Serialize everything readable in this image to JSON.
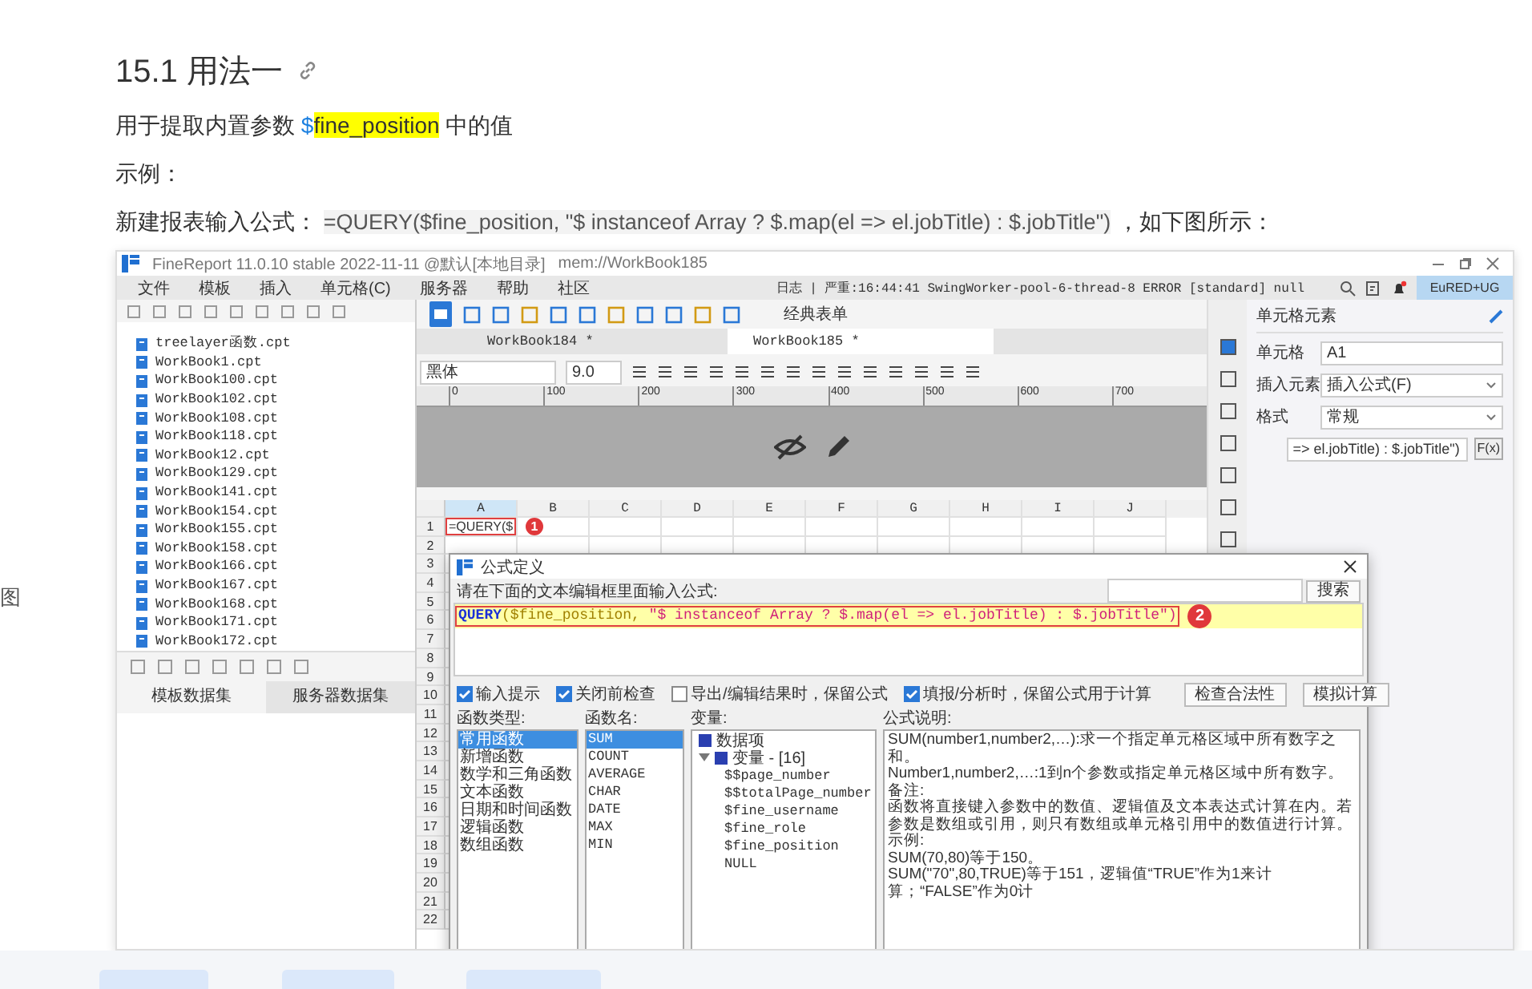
{
  "article": {
    "heading": "15.1 用法一",
    "paragraphs": [
      [
        {
          "text": "用于提取内置参数 ",
          "kind": "plain"
        },
        {
          "text": "$",
          "kind": "dollar"
        },
        {
          "text": "fine_position",
          "kind": "highlight"
        },
        {
          "text": " 中的值",
          "kind": "plain"
        }
      ],
      [
        {
          "text": "示例：",
          "kind": "plain"
        }
      ],
      [
        {
          "text": "新建报表输入公式： ",
          "kind": "plain"
        },
        {
          "text": "=QUERY($",
          "kind": "code"
        },
        {
          "text": "fine_position",
          "kind": "code-highlight"
        },
        {
          "text": ", \"$ instanceof Array ? $.map(el => el.jobTitle) : $.jobTitle\")",
          "kind": "code"
        },
        {
          "text": " ，如下图所示：",
          "kind": "plain"
        }
      ]
    ]
  },
  "left_fragment": "图",
  "app": {
    "title": "FineReport 11.0.10 stable 2022-11-11 @默认[本地目录]",
    "path": "mem://WorkBook185",
    "menu": [
      "文件",
      "模板",
      "插入",
      "单元格(C)",
      "服务器",
      "帮助",
      "社区"
    ],
    "log": "日志 | 严重:16:44:41 SwingWorker-pool-6-thread-8 ERROR [standard] null",
    "user": "EuRED+UG",
    "files": [
      "treelayer函数.cpt",
      "WorkBook1.cpt",
      "WorkBook100.cpt",
      "WorkBook102.cpt",
      "WorkBook108.cpt",
      "WorkBook118.cpt",
      "WorkBook12.cpt",
      "WorkBook129.cpt",
      "WorkBook141.cpt",
      "WorkBook154.cpt",
      "WorkBook155.cpt",
      "WorkBook158.cpt",
      "WorkBook166.cpt",
      "WorkBook167.cpt",
      "WorkBook168.cpt",
      "WorkBook171.cpt",
      "WorkBook172.cpt"
    ],
    "dataset_tabs": [
      {
        "label": "模板数据集",
        "selected": true
      },
      {
        "label": "服务器数据集",
        "selected": false
      }
    ],
    "style_button": "经典表单",
    "doc_tabs": [
      {
        "label": "WorkBook184 *",
        "selected": false
      },
      {
        "label": "WorkBook185 *",
        "selected": true
      }
    ],
    "font": "黑体",
    "font_size": "9.0",
    "ruler": [
      "0",
      "100",
      "200",
      "300",
      "400",
      "500",
      "600",
      "700"
    ],
    "grid": {
      "columns": [
        "A",
        "B",
        "C",
        "D",
        "E",
        "F",
        "G",
        "H",
        "I",
        "J"
      ],
      "rows": [
        {
          "label": "1",
          "cell": "=QUERY($"
        },
        {
          "label": "2"
        },
        {
          "label": "3"
        },
        {
          "label": "4"
        },
        {
          "label": "5"
        },
        {
          "label": "6"
        },
        {
          "label": "7"
        },
        {
          "label": "8"
        },
        {
          "label": "9"
        },
        {
          "label": "10"
        },
        {
          "label": "11"
        },
        {
          "label": "12"
        },
        {
          "label": "13"
        },
        {
          "label": "14"
        },
        {
          "label": "15"
        },
        {
          "label": "16"
        },
        {
          "label": "17"
        },
        {
          "label": "18"
        },
        {
          "label": "19"
        },
        {
          "label": "20"
        },
        {
          "label": "21"
        },
        {
          "label": "22"
        }
      ]
    },
    "markers": [
      "1",
      "2"
    ],
    "cell_panel": {
      "title": "单元格元素",
      "fields": [
        {
          "label": "单元格",
          "value": "A1",
          "kind": "text"
        },
        {
          "label": "插入元素",
          "value": "插入公式(F)",
          "kind": "select"
        },
        {
          "label": "格式",
          "value": "常规",
          "kind": "select"
        },
        {
          "value": "=> el.jobTitle) : $.jobTitle\")",
          "kind": "formula",
          "button": "F(x)"
        }
      ]
    },
    "dialog": {
      "title": "公式定义",
      "prompt": "请在下面的文本编辑框里面输入公式:",
      "search_button": "搜索",
      "formula": [
        {
          "text": "QUERY",
          "kind": "function"
        },
        {
          "text": "($fine_position, ",
          "kind": "param"
        },
        {
          "text": "\"$ instanceof Array ? $.map(el => el.jobTitle) : $.jobTitle\")",
          "kind": "string"
        }
      ],
      "options": [
        {
          "label": "输入提示",
          "checked": true
        },
        {
          "label": "关闭前检查",
          "checked": true
        },
        {
          "label": "导出/编辑结果时，保留公式",
          "checked": false
        },
        {
          "label": "填报/分析时，保留公式用于计算",
          "checked": true
        }
      ],
      "buttons": [
        "检查合法性",
        "模拟计算"
      ],
      "function_types": {
        "label": "函数类型:",
        "items": [
          {
            "label": "常用函数",
            "selected": true
          },
          {
            "label": "新增函数",
            "selected": false
          },
          {
            "label": "数学和三角函数",
            "selected": false
          },
          {
            "label": "文本函数",
            "selected": false
          },
          {
            "label": "日期和时间函数",
            "selected": false
          },
          {
            "label": "逻辑函数",
            "selected": false
          },
          {
            "label": "数组函数",
            "selected": false
          }
        ]
      },
      "function_names": {
        "label": "函数名:",
        "items": [
          {
            "label": "SUM",
            "selected": true
          },
          {
            "label": "COUNT",
            "selected": false
          },
          {
            "label": "AVERAGE",
            "selected": false
          },
          {
            "label": "CHAR",
            "selected": false
          },
          {
            "label": "DATE",
            "selected": false
          },
          {
            "label": "MAX",
            "selected": false
          },
          {
            "label": "MIN",
            "selected": false
          }
        ]
      },
      "variables": {
        "label": "变量:",
        "items": [
          {
            "label": "数据项"
          },
          {
            "label": "变量 - [16]",
            "expanded": true,
            "children": [
              {
                "label": "$$page_number"
              },
              {
                "label": "$$totalPage_number"
              },
              {
                "label": "$fine_username"
              },
              {
                "label": "$fine_role"
              },
              {
                "label": "$fine_position"
              },
              {
                "label": "NULL"
              }
            ]
          }
        ]
      },
      "description": {
        "label": "公式说明:",
        "lines": [
          "SUM(number1,number2,…):求一个指定单元格区域中所有数字之和。",
          "Number1,number2,…:1到n个参数或指定单元格区域中所有数字。",
          "备注:",
          "函数将直接键入参数中的数值、逻辑值及文本表达式计算在内。若参数是数组或引用，则只有数组或单元格引用中的数值进行计算。",
          "示例:",
          "SUM(70,80)等于150。",
          "SUM(\"70\",80,TRUE)等于151，逻辑值“TRUE”作为1来计算；“FALSE”作为0计"
        ]
      }
    }
  }
}
